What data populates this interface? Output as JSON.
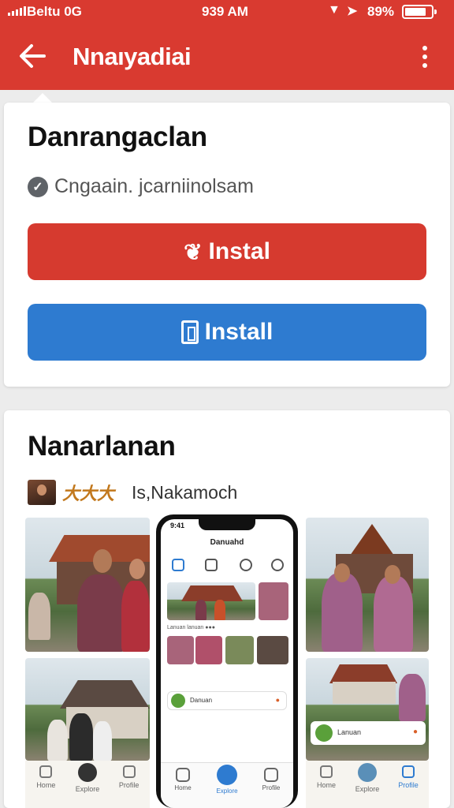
{
  "status_bar": {
    "carrier": "Beltu  0G",
    "time": "939 AM",
    "battery": "89%"
  },
  "app_bar": {
    "title": "Nnaıyadiai"
  },
  "app_card": {
    "name": "Danrangaclan",
    "publisher": "Cngaain. jcarniinolsam",
    "install_primary_label": "Instal",
    "install_secondary_label": "Install"
  },
  "screenshots_card": {
    "title": "Nanarlanan",
    "developer_badge": "大大大",
    "developer_name": "Is,Nakamoch",
    "phone_screen_title": "Danuahd",
    "phone_list_items": [
      {
        "title": "Danuan",
        "action": "●"
      },
      {
        "title": "Lanuan",
        "action": "●"
      }
    ]
  },
  "colors": {
    "app_bar": "#d93a30",
    "install_red": "#d63a2f",
    "install_blue": "#2e7bd0"
  }
}
